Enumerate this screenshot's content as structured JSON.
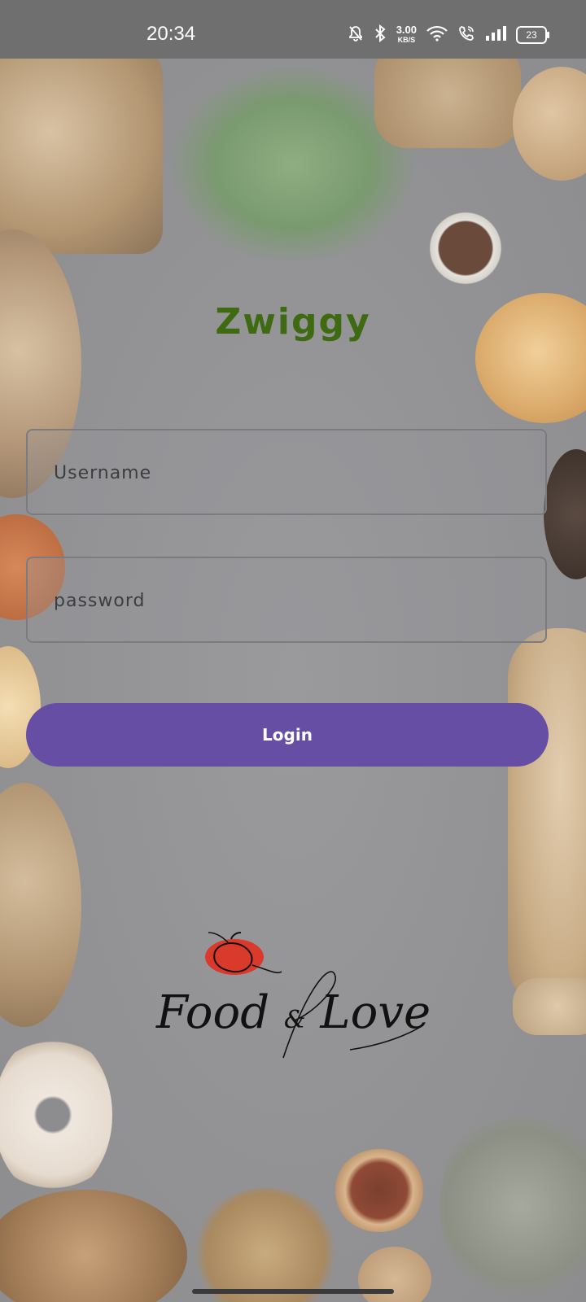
{
  "status_bar": {
    "time": "20:34",
    "speed_value": "3.00",
    "speed_unit": "KB/S",
    "battery": "23",
    "icons": [
      "mute-bell-icon",
      "bluetooth-icon",
      "wifi-icon",
      "volte-call-icon",
      "signal-icon",
      "battery-icon"
    ]
  },
  "login": {
    "title": "Zwiggy",
    "username_placeholder": "Username",
    "password_placeholder": "password",
    "login_label": "Login"
  },
  "logo": {
    "text_main": "Food",
    "text_amp": "&",
    "text_tail": "Love"
  },
  "colors": {
    "title": "#3e6a12",
    "button": "#654ea3",
    "logo_accent": "#d93a2a"
  }
}
